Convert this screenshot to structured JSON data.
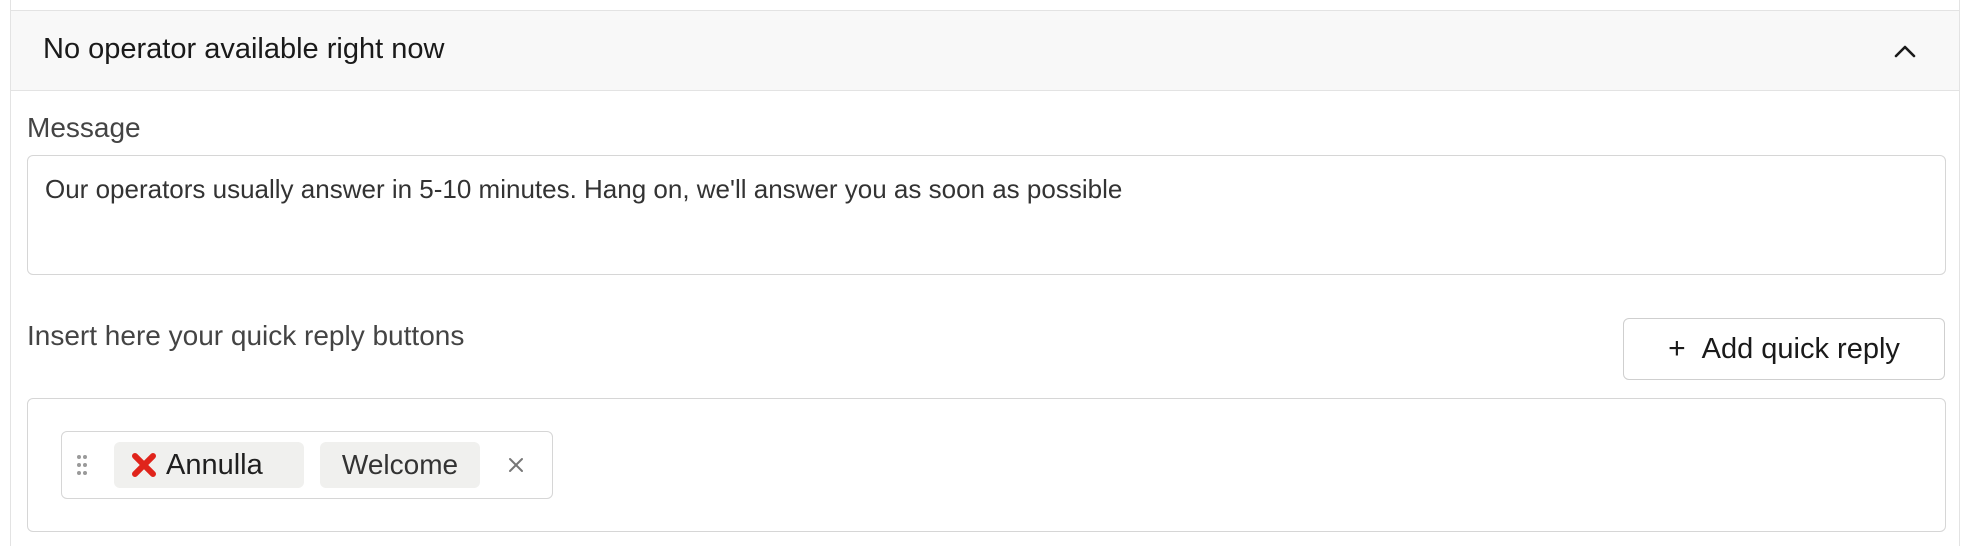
{
  "panel": {
    "title": "No operator available right now",
    "collapse_icon": "chevron-up-icon"
  },
  "message": {
    "label": "Message",
    "value": "Our operators usually answer in 5-10 minutes. Hang on, we'll answer you as soon as possible"
  },
  "quick_replies": {
    "label": "Insert here your quick reply buttons",
    "add_button_label": "Add quick reply",
    "add_icon": "plus-icon",
    "groups": [
      {
        "drag_icon": "drag-handle-icon",
        "buttons": [
          {
            "emoji_icon": "cross-mark-icon",
            "label": "Annulla"
          },
          {
            "label": "Welcome"
          }
        ],
        "remove_icon": "close-icon"
      }
    ]
  },
  "colors": {
    "header_bg": "#f8f8f8",
    "border": "#d6d6d6",
    "chip_bg": "#f0f0ee",
    "cross_red": "#e0241b"
  }
}
